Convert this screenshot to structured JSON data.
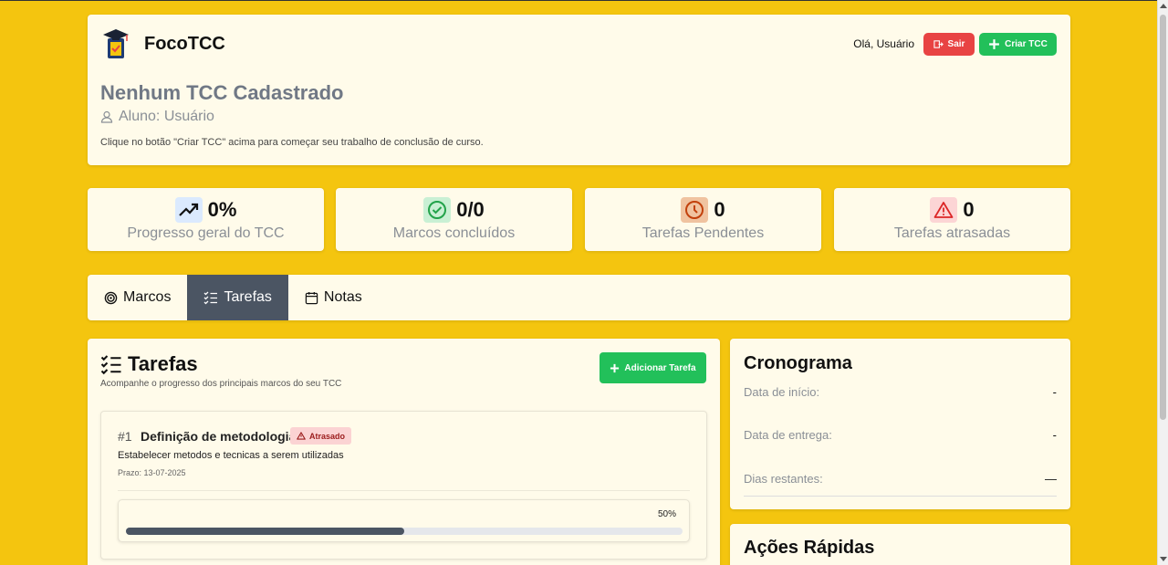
{
  "header": {
    "brand": "FocoTCC",
    "greeting": "Olá, Usuário",
    "logout_label": "Sair",
    "create_label": "Criar TCC",
    "title": "Nenhum TCC Cadastrado",
    "student": "Aluno: Usuário",
    "hint": "Clique no botão \"Criar TCC\" acima para começar seu trabalho de conclusão de curso."
  },
  "stats": [
    {
      "value": "0%",
      "label": "Progresso geral do TCC",
      "icon": "trending-up-icon"
    },
    {
      "value": "0/0",
      "label": "Marcos concluídos",
      "icon": "check-circle-icon"
    },
    {
      "value": "0",
      "label": "Tarefas Pendentes",
      "icon": "clock-icon"
    },
    {
      "value": "0",
      "label": "Tarefas atrasadas",
      "icon": "alert-triangle-icon"
    }
  ],
  "tabs": [
    {
      "label": "Marcos",
      "icon": "target-icon",
      "active": false
    },
    {
      "label": "Tarefas",
      "icon": "list-checks-icon",
      "active": true
    },
    {
      "label": "Notas",
      "icon": "calendar-icon",
      "active": false
    }
  ],
  "tasks": {
    "title": "Tarefas",
    "subtitle": "Acompanhe o progresso dos principais marcos do seu TCC",
    "add_label": "Adicionar Tarefa",
    "items": [
      {
        "number": "#1",
        "name": "Definição de metodologia",
        "status": "Atrasado",
        "description": "Estabelecer metodos e tecnicas a serem utilizadas",
        "due": "Prazo: 13-07-2025",
        "progress_label": "50%",
        "progress": 0.5
      }
    ]
  },
  "schedule": {
    "title": "Cronograma",
    "rows": [
      {
        "label": "Data de início:",
        "value": "-"
      },
      {
        "label": "Data de entrega:",
        "value": "-"
      },
      {
        "label": "Dias restantes:",
        "value": "—"
      }
    ]
  },
  "quick_actions": {
    "title": "Ações Rápidas"
  },
  "colors": {
    "background": "#f4c50f",
    "card": "#fffbea",
    "danger": "#e84343",
    "success": "#22c05a",
    "active_tab": "#4b5563"
  }
}
